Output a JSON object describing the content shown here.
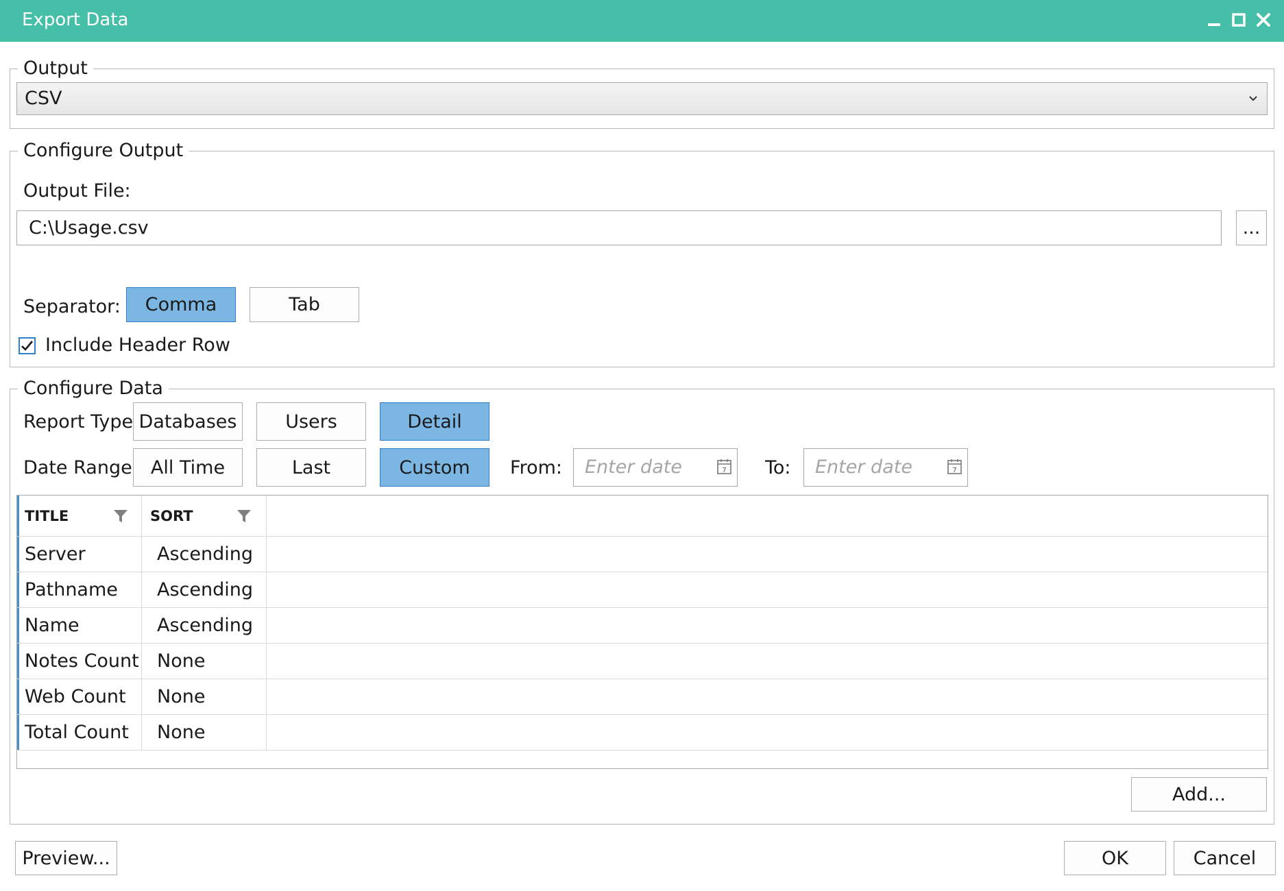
{
  "window": {
    "title": "Export Data"
  },
  "output": {
    "legend": "Output",
    "selected": "CSV"
  },
  "configure_output": {
    "legend": "Configure Output",
    "file_label": "Output File:",
    "file_value": "C:\\Usage.csv",
    "browse_label": "...",
    "separator_label": "Separator:",
    "separators": [
      {
        "label": "Comma",
        "selected": true
      },
      {
        "label": "Tab",
        "selected": false
      }
    ],
    "header_row_label": "Include Header Row",
    "header_row_checked": true
  },
  "configure_data": {
    "legend": "Configure Data",
    "report_type_label": "Report Type",
    "report_types": [
      {
        "label": "Databases",
        "selected": false
      },
      {
        "label": "Users",
        "selected": false
      },
      {
        "label": "Detail",
        "selected": true
      }
    ],
    "date_range_label": "Date Range:",
    "date_ranges": [
      {
        "label": "All Time",
        "selected": false
      },
      {
        "label": "Last",
        "selected": false
      },
      {
        "label": "Custom",
        "selected": true
      }
    ],
    "from_label": "From:",
    "to_label": "To:",
    "date_placeholder": "Enter date",
    "date_icon_digit": "7",
    "columns": {
      "title": "TITLE",
      "sort": "SORT"
    },
    "rows": [
      {
        "title": "Server",
        "sort": "Ascending"
      },
      {
        "title": "Pathname",
        "sort": "Ascending"
      },
      {
        "title": "Name",
        "sort": "Ascending"
      },
      {
        "title": "Notes Count",
        "sort": "None"
      },
      {
        "title": "Web Count",
        "sort": "None"
      },
      {
        "title": "Total Count",
        "sort": "None"
      }
    ],
    "add_label": "Add..."
  },
  "footer": {
    "preview_label": "Preview...",
    "ok_label": "OK",
    "cancel_label": "Cancel"
  },
  "colors": {
    "titlebar": "#45bfa8",
    "selected_button": "#7cb6e3",
    "selected_border": "#2f7fcb"
  }
}
